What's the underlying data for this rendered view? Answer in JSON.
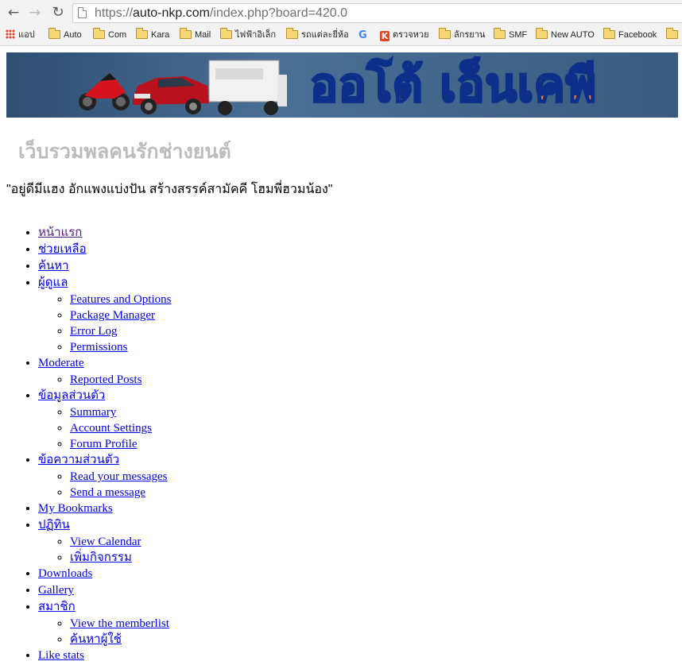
{
  "browser": {
    "url_protocol": "https://",
    "url_host": "auto-nkp.com",
    "url_path": "/index.php?board=420.0",
    "bookmarks": [
      {
        "label": "แอป",
        "icon": "apps-grid-icon"
      },
      {
        "label": "Auto",
        "icon": "folder-icon"
      },
      {
        "label": "Com",
        "icon": "folder-icon"
      },
      {
        "label": "Kara",
        "icon": "folder-icon"
      },
      {
        "label": "Mail",
        "icon": "folder-icon"
      },
      {
        "label": "ไฟฟ้าอิเล็ก",
        "icon": "folder-icon"
      },
      {
        "label": "รถแต่ละยี่ห้อ",
        "icon": "folder-icon"
      },
      {
        "label": "",
        "icon": "google-icon"
      },
      {
        "label": "ตรวจหวย",
        "icon": "k-icon"
      },
      {
        "label": "ลักรยาน",
        "icon": "folder-icon"
      },
      {
        "label": "SMF",
        "icon": "folder-icon"
      },
      {
        "label": "New AUTO",
        "icon": "folder-icon"
      },
      {
        "label": "Facebook",
        "icon": "folder-icon"
      }
    ]
  },
  "site": {
    "banner_title": "ออโต้ เอ็นเคพี",
    "subtitle": "เว็บรวมพลคนรักช่างยนต์",
    "slogan": "\"อยู่ดีมีแฮง อักแพงแบ่งปัน สร้างสรรค์สามัคคี โฮมพี่ฮวมน้อง\""
  },
  "menu": {
    "home": "หน้าแรก",
    "help": "ช่วยเหลือ",
    "search": "ค้นหา",
    "admin": "ผู้ดูแล",
    "admin_items": [
      "Features and Options",
      "Package Manager",
      "Error Log",
      "Permissions"
    ],
    "moderate": "Moderate",
    "moderate_items": [
      "Reported Posts"
    ],
    "profile": "ข้อมูลส่วนตัว",
    "profile_items": [
      "Summary",
      "Account Settings",
      "Forum Profile"
    ],
    "pm": "ข้อความส่วนตัว",
    "pm_items": [
      "Read your messages",
      "Send a message"
    ],
    "bookmarks": "My Bookmarks",
    "calendar": "ปฏิทิน",
    "calendar_items": [
      "View Calendar",
      "เพิ่มกิจกรรม"
    ],
    "downloads": "Downloads",
    "gallery": "Gallery",
    "members": "สมาชิก",
    "members_items": [
      "View the memberlist",
      "ค้นหาผู้ใช้"
    ],
    "like_stats": "Like stats"
  }
}
